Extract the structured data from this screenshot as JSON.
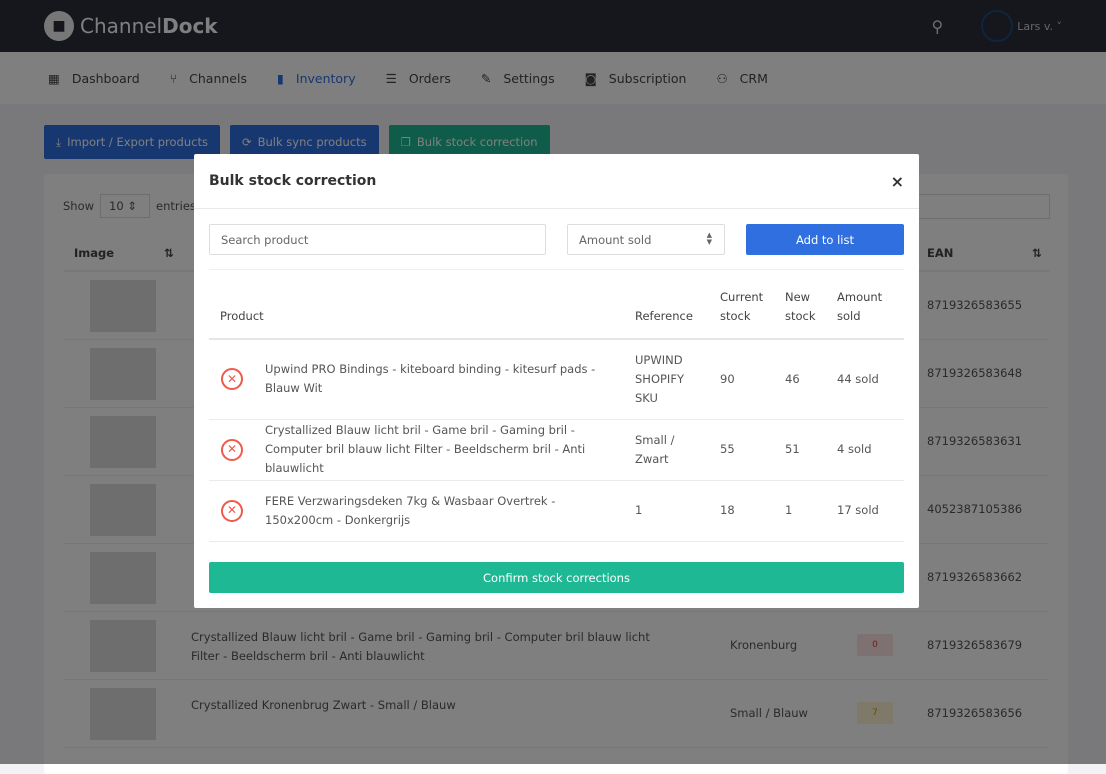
{
  "app": {
    "brand_light": "Channel",
    "brand_bold": "Dock",
    "user": "Lars v."
  },
  "nav": [
    {
      "label": "Dashboard",
      "icon": "grid-icon"
    },
    {
      "label": "Channels",
      "icon": "branch-icon"
    },
    {
      "label": "Inventory",
      "icon": "database-icon",
      "active": true
    },
    {
      "label": "Orders",
      "icon": "list-icon"
    },
    {
      "label": "Settings",
      "icon": "wrench-icon"
    },
    {
      "label": "Subscription",
      "icon": "camera-icon"
    },
    {
      "label": "CRM",
      "icon": "user-icon"
    }
  ],
  "actions": {
    "import": "Import / Export products",
    "sync": "Bulk sync products",
    "correction": "Bulk stock correction"
  },
  "bg_table": {
    "show": "Show",
    "entries_value": "10",
    "entries": "entries",
    "col_image": "Image",
    "col_ean": "EAN",
    "rows": [
      {
        "title": "",
        "variant": "",
        "badge": "",
        "ean": "8719326583655"
      },
      {
        "title": "",
        "variant": "",
        "badge": "",
        "ean": "8719326583648"
      },
      {
        "title": "",
        "variant": "",
        "badge": "",
        "ean": "8719326583631"
      },
      {
        "title": "",
        "variant": "",
        "badge": "",
        "ean": "4052387105386"
      },
      {
        "title": "",
        "variant": "",
        "badge": "",
        "ean": "8719326583662"
      },
      {
        "title": "Crystallized Blauw licht bril - Game bril - Gaming bril - Computer bril blauw licht Filter - Beeldscherm bril - Anti blauwlicht",
        "variant": "Kronenburg",
        "badge": "0",
        "ean": "8719326583679"
      },
      {
        "title": "Crystallized Kronenbrug Zwart - Small / Blauw",
        "variant": "Small / Blauw",
        "badge": "7",
        "ean": "8719326583656"
      }
    ]
  },
  "modal": {
    "title": "Bulk stock correction",
    "close": "×",
    "search_placeholder": "Search product",
    "amount_placeholder": "Amount sold",
    "add": "Add to list",
    "headers": {
      "product": "Product",
      "reference": "Reference",
      "current": "Current stock",
      "new": "New stock",
      "sold": "Amount sold"
    },
    "rows": [
      {
        "product": "Upwind PRO Bindings - kiteboard binding - kitesurf pads - Blauw Wit",
        "reference": "UPWIND SHOPIFY SKU",
        "current": "90",
        "new": "46",
        "sold": "44 sold"
      },
      {
        "product": "Crystallized Blauw licht bril - Game bril - Gaming bril - Computer bril blauw licht Filter - Beeldscherm bril - Anti blauwlicht",
        "reference": "Small / Zwart",
        "current": "55",
        "new": "51",
        "sold": "4 sold"
      },
      {
        "product": "FERE Verzwaringsdeken 7kg & Wasbaar Overtrek - 150x200cm - Donkergrijs",
        "reference": "1",
        "current": "18",
        "new": "1",
        "sold": "17 sold"
      }
    ],
    "confirm": "Confirm stock corrections"
  },
  "colors": {
    "primary": "#2f6fe0",
    "success": "#1fb894",
    "danger": "#ef5a4a",
    "header": "#2b2f3a"
  }
}
